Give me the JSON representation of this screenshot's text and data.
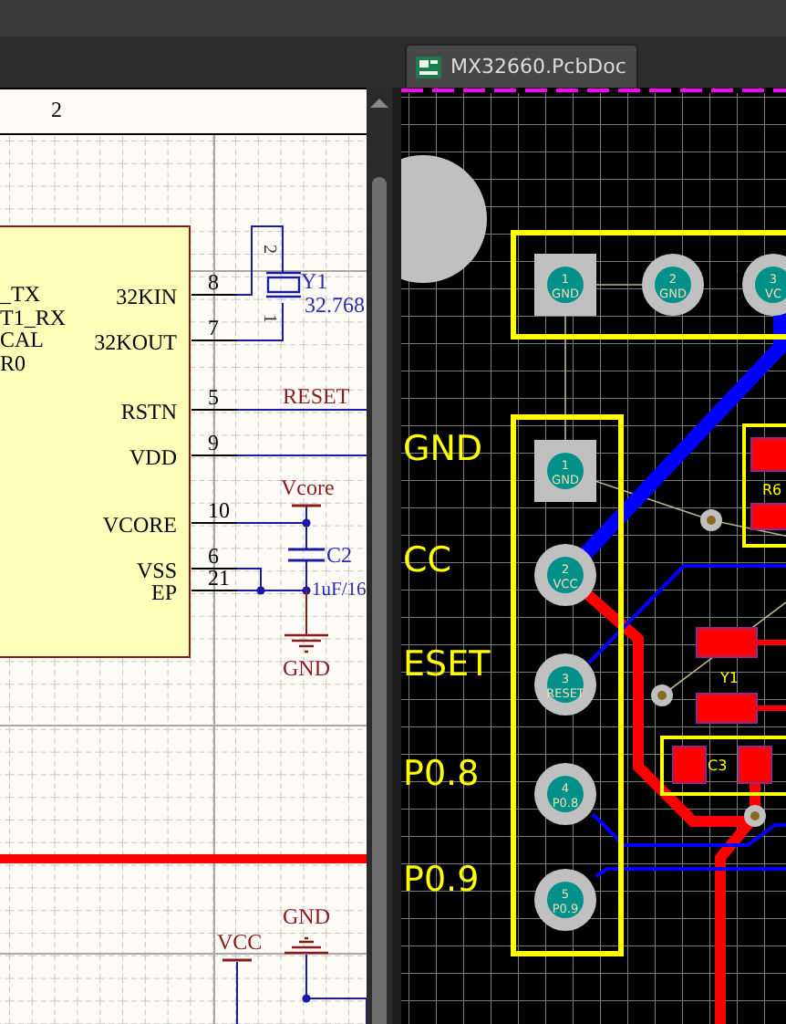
{
  "schematic": {
    "column_label": "2",
    "chip": {
      "left_pins": [
        "_TX",
        "T1_RX",
        "CAL",
        "R0"
      ],
      "right_pins": [
        {
          "name": "32KIN",
          "number": "8"
        },
        {
          "name": "32KOUT",
          "number": "7"
        },
        {
          "name": "RSTN",
          "number": "5"
        },
        {
          "name": "VDD",
          "number": "9"
        },
        {
          "name": "VCORE",
          "number": "10"
        },
        {
          "name": "VSS",
          "number": "6"
        },
        {
          "name": "EP",
          "number": "21"
        }
      ]
    },
    "crystal": {
      "designator": "Y1",
      "value": "32.768",
      "pin_numbers": [
        "2",
        "1"
      ]
    },
    "capacitor": {
      "designator": "C2",
      "value": "1uF/16"
    },
    "net_labels": [
      {
        "text": "RESET",
        "kind": "net"
      },
      {
        "text": "Vcore",
        "kind": "power"
      },
      {
        "text": "GND",
        "kind": "ground"
      },
      {
        "text": "GND",
        "kind": "ground"
      },
      {
        "text": "VCC",
        "kind": "power"
      }
    ]
  },
  "pcb": {
    "tab": {
      "title": "MX32660.PcbDoc",
      "selected": true
    },
    "top_header_pads": [
      {
        "number": "1",
        "net": "GND",
        "kind": "square"
      },
      {
        "number": "2",
        "net": "GND",
        "kind": "round"
      },
      {
        "number": "3",
        "net": "VC",
        "kind": "round"
      }
    ],
    "side_header_pads": [
      {
        "number": "1",
        "net": "GND",
        "kind": "square"
      },
      {
        "number": "2",
        "net": "VCC",
        "kind": "round"
      },
      {
        "number": "3",
        "net": "RESET",
        "kind": "round"
      },
      {
        "number": "4",
        "net": "P0.8",
        "kind": "round"
      },
      {
        "number": "5",
        "net": "P0.9",
        "kind": "round"
      }
    ],
    "silkscreen_labels": [
      "GND",
      "CC",
      "ESET",
      "P0.8",
      "P0.9"
    ],
    "component_labels": [
      "R6",
      "Y1",
      "C3"
    ]
  }
}
